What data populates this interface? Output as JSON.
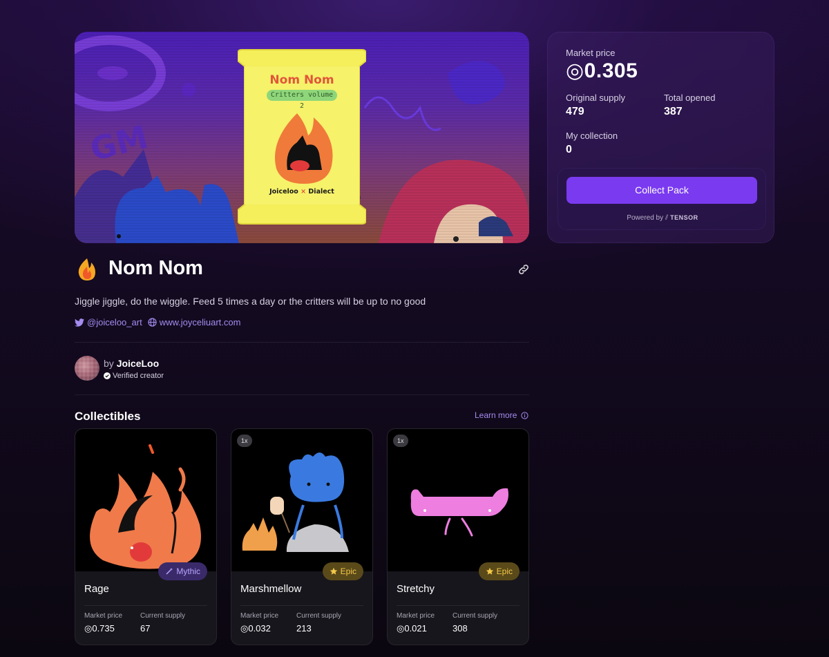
{
  "colors": {
    "accent": "#7a3af0",
    "link": "#a48cf0",
    "mythic": "#b9a6ff",
    "epic": "#f4c84a"
  },
  "hero": {
    "pack_title": "Nom Nom",
    "pack_subtitle": "Critters volume 2",
    "pack_brand_left": "Joiceloo",
    "pack_brand_sep": "×",
    "pack_brand_right": "Dialect"
  },
  "sidebar": {
    "market_price_label": "Market price",
    "market_price_value": "◎0.305",
    "original_supply_label": "Original supply",
    "original_supply_value": "479",
    "total_opened_label": "Total opened",
    "total_opened_value": "387",
    "my_collection_label": "My collection",
    "my_collection_value": "0",
    "collect_button": "Collect Pack",
    "powered_by": "Powered by",
    "powered_brand": "TENSOR"
  },
  "title": "Nom Nom",
  "description": "Jiggle jiggle, do the wiggle. Feed 5 times a day or the critters will be up to no good",
  "socials": {
    "twitter": "@joiceloo_art",
    "website": "www.joyceliuart.com"
  },
  "creator": {
    "by": "by",
    "name": "JoiceLoo",
    "verified": "Verified creator"
  },
  "collectibles": {
    "title": "Collectibles",
    "learn_more": "Learn more",
    "market_price_label": "Market price",
    "current_supply_label": "Current supply",
    "items": [
      {
        "name": "Rage",
        "rarity": "Mythic",
        "qty": "",
        "market_price": "◎0.735",
        "current_supply": "67"
      },
      {
        "name": "Marshmellow",
        "rarity": "Epic",
        "qty": "1x",
        "market_price": "◎0.032",
        "current_supply": "213"
      },
      {
        "name": "Stretchy",
        "rarity": "Epic",
        "qty": "1x",
        "market_price": "◎0.021",
        "current_supply": "308"
      }
    ]
  }
}
